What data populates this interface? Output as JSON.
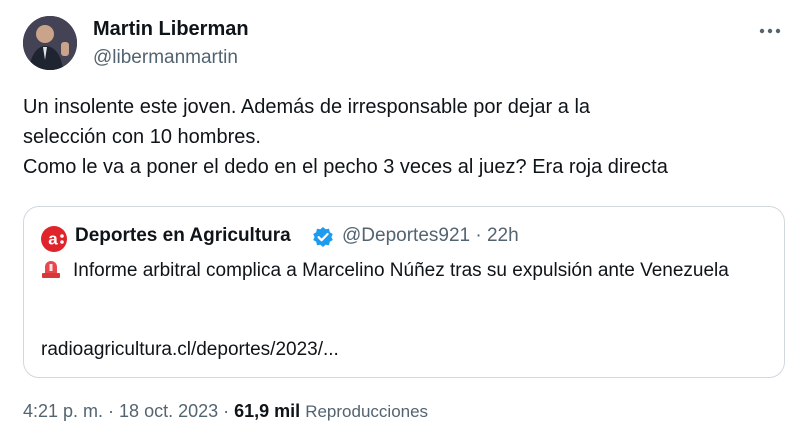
{
  "author": {
    "name": "Martin Liberman",
    "handle": "@libermanmartin"
  },
  "more_icon": "more-horizontal-icon",
  "tweet": {
    "lines": [
      "Un insolente este joven. Además de irresponsable por dejar a la",
      "selección con 10 hombres.",
      "Como le va a poner el dedo en el pecho 3 veces al juez? Era roja directa"
    ]
  },
  "quote": {
    "name": "Deportes en Agricultura",
    "handle": "@Deportes921",
    "separator": " · ",
    "time": "22h",
    "logo_icon": "agricultura-logo-icon",
    "verified_icon": "verified-badge-icon",
    "alarm_icon": "rotating-light-icon",
    "headline": "Informe arbitral complica a Marcelino Núñez tras su expulsión ante Venezuela",
    "link": "radioagricultura.cl/deportes/2023/..."
  },
  "meta": {
    "time": "4:21 p. m.",
    "separator": " · ",
    "date": "18 oct. 2023",
    "views_count": "61,9 mil",
    "views_label": "Reproducciones"
  },
  "colors": {
    "text": "#0f1419",
    "secondary": "#536471",
    "border": "#cfd9de",
    "verified": "#1d9bf0",
    "logo_red": "#e0242c"
  }
}
